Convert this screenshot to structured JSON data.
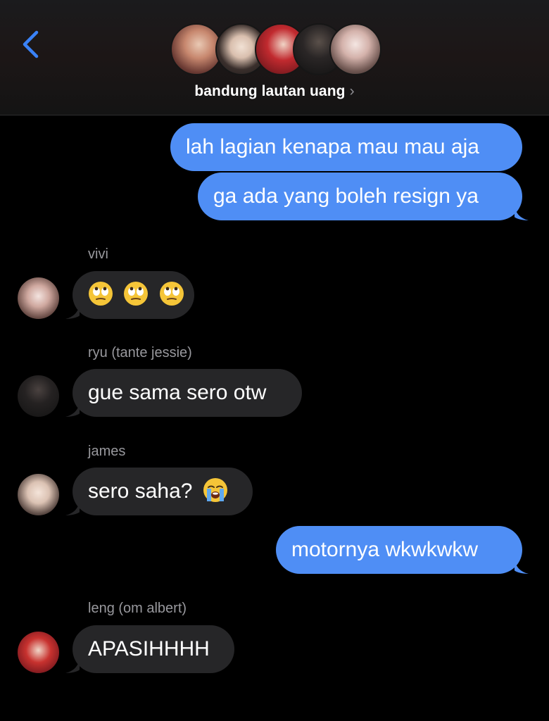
{
  "header": {
    "group_name": "bandung lautan uang",
    "chevron": "›",
    "back_icon": "chevron-left-icon",
    "accent": "#3a82f7"
  },
  "colors": {
    "outgoing_bubble": "#4f8ef5",
    "incoming_bubble": "#262628",
    "sender_label": "#98989d"
  },
  "messages": [
    {
      "direction": "outgoing",
      "text": "lah lagian kenapa mau mau aja"
    },
    {
      "direction": "outgoing",
      "text": "ga ada yang boleh resign ya"
    },
    {
      "direction": "incoming",
      "sender": "vivi",
      "text": "🙄🙄🙄",
      "emoji": [
        "eye-roll-emoji",
        "eye-roll-emoji",
        "eye-roll-emoji"
      ]
    },
    {
      "direction": "incoming",
      "sender": "ryu (tante jessie)",
      "text": "gue sama sero otw"
    },
    {
      "direction": "incoming",
      "sender": "james",
      "text": "sero saha?",
      "emoji": [
        "loudly-crying-emoji"
      ]
    },
    {
      "direction": "outgoing",
      "text": "motornya wkwkwkw"
    },
    {
      "direction": "incoming",
      "sender": "leng (om albert)",
      "text": "APASIHHHH"
    }
  ]
}
